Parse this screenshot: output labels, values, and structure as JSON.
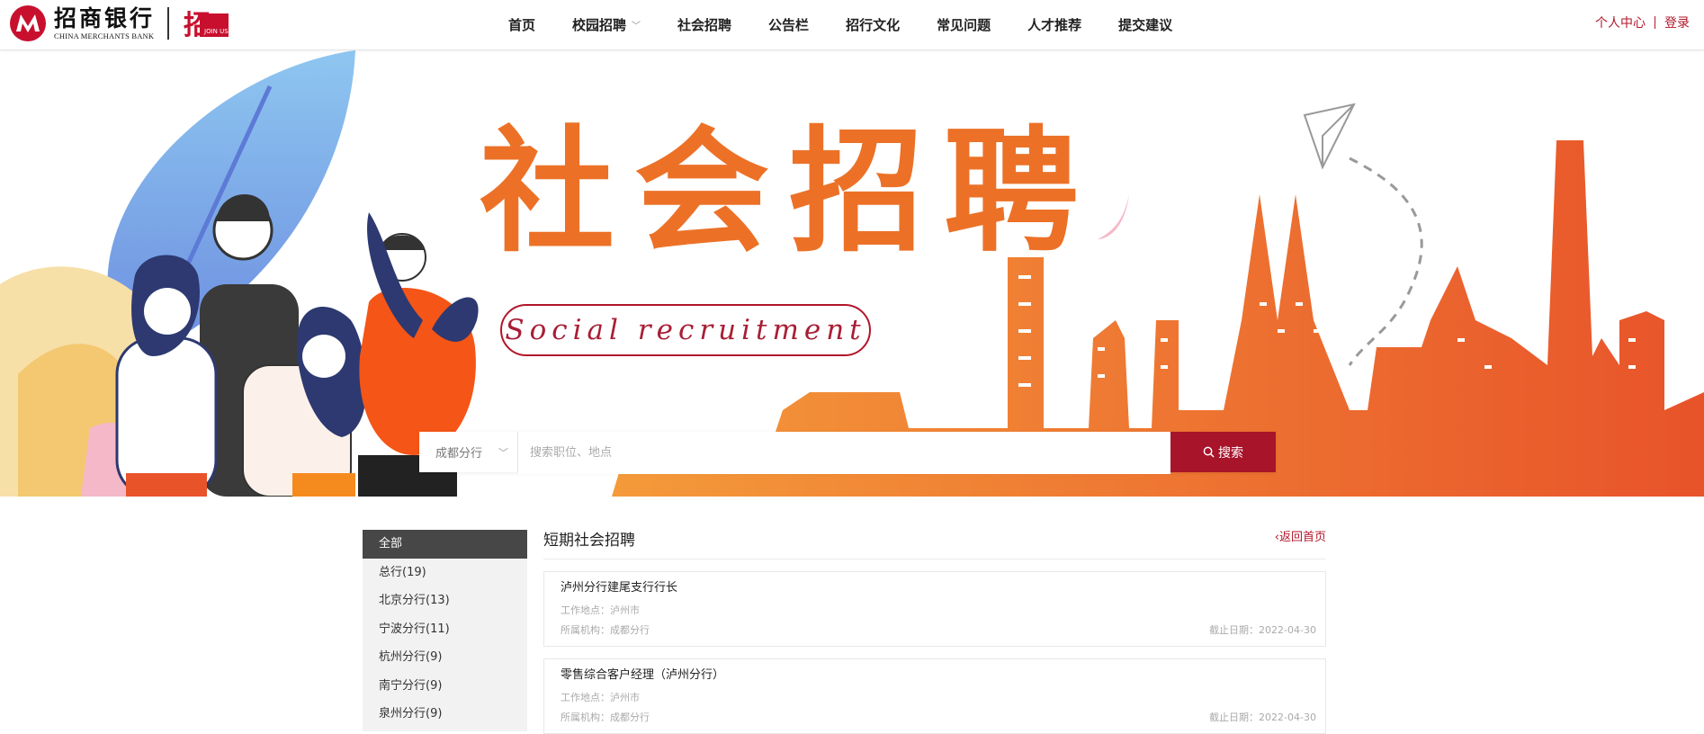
{
  "brand": {
    "name_cn": "招商银行",
    "name_en": "CHINA MERCHANTS BANK",
    "join_label": "招",
    "join_small": "JOIN US",
    "red": "#b2162a"
  },
  "nav": {
    "items": [
      {
        "label": "首页"
      },
      {
        "label": "校园招聘",
        "has_dropdown": true
      },
      {
        "label": "社会招聘"
      },
      {
        "label": "公告栏"
      },
      {
        "label": "招行文化"
      },
      {
        "label": "常见问题"
      },
      {
        "label": "人才推荐"
      },
      {
        "label": "提交建议"
      }
    ]
  },
  "user": {
    "profile_label": "个人中心",
    "login_label": "登录"
  },
  "banner": {
    "title": "社会招聘",
    "subtitle": "Social recruitment"
  },
  "search": {
    "branch_value": "成都分行",
    "placeholder": "搜索职位、地点",
    "button_label": "搜索"
  },
  "sidebar": {
    "items": [
      {
        "label": "全部",
        "active": true
      },
      {
        "label": "总行(19)"
      },
      {
        "label": "北京分行(13)"
      },
      {
        "label": "宁波分行(11)"
      },
      {
        "label": "杭州分行(9)"
      },
      {
        "label": "南宁分行(9)"
      },
      {
        "label": "泉州分行(9)"
      }
    ]
  },
  "content": {
    "title": "短期社会招聘",
    "back_label": "返回首页",
    "jobs": [
      {
        "title": "泸州分行建尾支行行长",
        "location": "工作地点：泸州市",
        "org": "所属机构：成都分行",
        "deadline": "截止日期：2022-04-30"
      },
      {
        "title": "零售综合客户经理（泸州分行）",
        "location": "工作地点：泸州市",
        "org": "所属机构：成都分行",
        "deadline": "截止日期：2022-04-30"
      }
    ]
  }
}
